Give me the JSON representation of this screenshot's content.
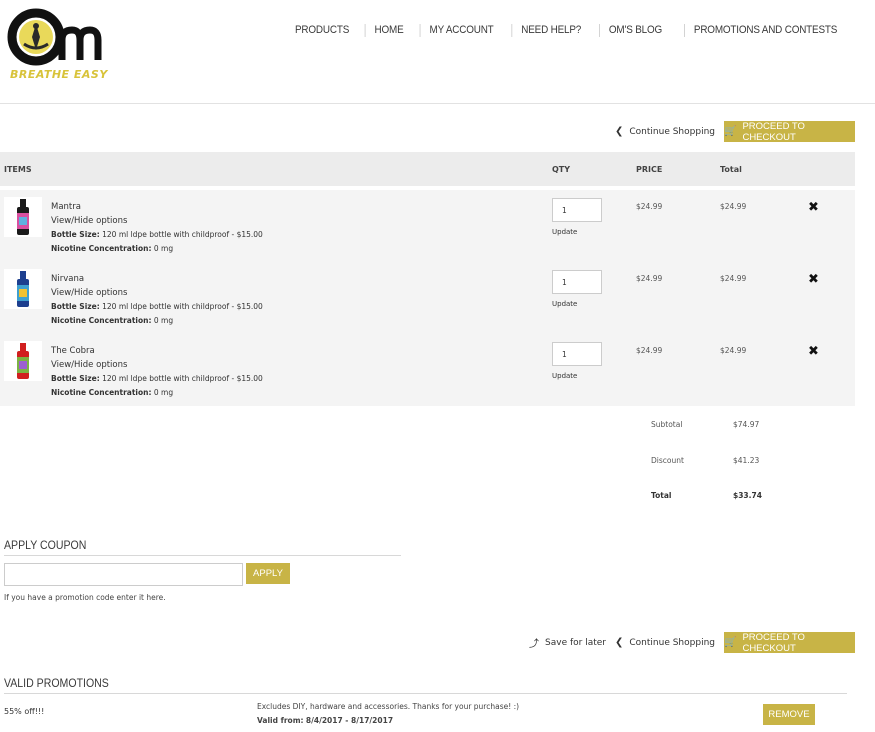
{
  "brand": {
    "logo_text": "Om",
    "tagline": "BREATHE EASY"
  },
  "nav": {
    "items": [
      {
        "label": "PRODUCTS"
      },
      {
        "label": "HOME"
      },
      {
        "label": "MY ACCOUNT"
      },
      {
        "label": "NEED HELP?"
      },
      {
        "label": "OM'S BLOG"
      },
      {
        "label": "PROMOTIONS AND CONTESTS"
      }
    ]
  },
  "actions": {
    "continue_shopping": "Continue Shopping",
    "proceed_to_checkout": "PROCEED TO CHECKOUT",
    "save_for_later": "Save for later"
  },
  "table": {
    "headers": {
      "items": "ITEMS",
      "qty": "QTY",
      "price": "PRICE",
      "total": "Total"
    },
    "rows": [
      {
        "name": "Mantra",
        "options_link": "View/Hide options",
        "bottle_label": "Bottle Size:",
        "bottle_value": "120 ml ldpe bottle with childproof - $15.00",
        "nicotine_label": "Nicotine Concentration:",
        "nicotine_value": "0 mg",
        "qty": "1",
        "update": "Update",
        "price": "$24.99",
        "total": "$24.99",
        "cap_color": "#1a1a1a",
        "label_color": "#d94fa0"
      },
      {
        "name": "Nirvana",
        "options_link": "View/Hide options",
        "bottle_label": "Bottle Size:",
        "bottle_value": "120 ml ldpe bottle with childproof - $15.00",
        "nicotine_label": "Nicotine Concentration:",
        "nicotine_value": "0 mg",
        "qty": "1",
        "update": "Update",
        "price": "$24.99",
        "total": "$24.99",
        "cap_color": "#1d3f8f",
        "label_color": "#3fa0d0"
      },
      {
        "name": "The Cobra",
        "options_link": "View/Hide options",
        "bottle_label": "Bottle Size:",
        "bottle_value": "120 ml ldpe bottle with childproof - $15.00",
        "nicotine_label": "Nicotine Concentration:",
        "nicotine_value": "0 mg",
        "qty": "1",
        "update": "Update",
        "price": "$24.99",
        "total": "$24.99",
        "cap_color": "#d11f1f",
        "label_color": "#7cb342"
      }
    ]
  },
  "summary": {
    "subtotal_label": "Subtotal",
    "subtotal_value": "$74.97",
    "discount_label": "Discount",
    "discount_value": "$41.23",
    "total_label": "Total",
    "total_value": "$33.74"
  },
  "coupon": {
    "title": "APPLY COUPON",
    "input_value": "",
    "apply_label": "APPLY",
    "help": "If you have a promotion code enter it here."
  },
  "promotions": {
    "title": "VALID PROMOTIONS",
    "items": [
      {
        "name": "55% off!!!",
        "description": "Excludes DIY, hardware and accessories. Thanks for your purchase! :)",
        "valid_label": "Valid from:",
        "valid_value": "8/4/2017 - 8/17/2017",
        "remove_label": "REMOVE"
      }
    ]
  },
  "colors": {
    "accent": "#c8b446",
    "row_bg": "#f4f4f4",
    "header_bg": "#ececec"
  }
}
